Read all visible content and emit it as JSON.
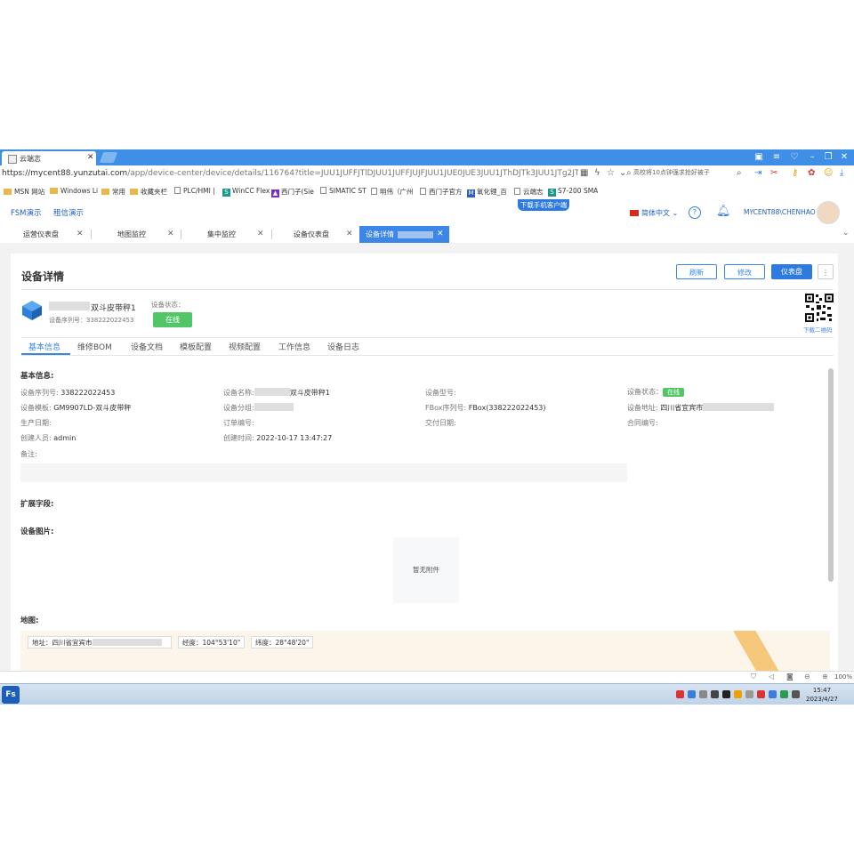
{
  "browser": {
    "tab_title": "云端志",
    "url_host": "https://mycent88.yunzutai.com",
    "url_path": "/app/device-center/device/details/116764?title=JUU1JUFFJTlDJUU1JUFFJUJFJUU1JUE0JUE3JUU1JThDJTk3JUU1JTg2JTlDJUU1JThGJThDJUUl",
    "search_placeholder": "高校将10点钟强求抢好被子"
  },
  "bookmarks": [
    {
      "label": "MSN 网站",
      "icon": "folder-icon"
    },
    {
      "label": "Windows Li",
      "icon": "folder-icon"
    },
    {
      "label": "常用",
      "icon": "folder-icon"
    },
    {
      "label": "收藏夹栏",
      "icon": "folder-icon"
    },
    {
      "label": "PLC/HMI |",
      "icon": "page-icon"
    },
    {
      "label": "WinCC Flex",
      "icon": "s-icon"
    },
    {
      "label": "西门子(Sie",
      "icon": "triangle-icon"
    },
    {
      "label": "SIMATIC ST",
      "icon": "page-icon"
    },
    {
      "label": "明伟（广州",
      "icon": "page-icon"
    },
    {
      "label": "西门子官方",
      "icon": "page-icon"
    },
    {
      "label": "氧化锂_百",
      "icon": "m-icon"
    },
    {
      "label": "云端志",
      "icon": "page-icon"
    },
    {
      "label": "S7-200 SMA",
      "icon": "s-icon"
    }
  ],
  "header": {
    "nav": [
      "FSM演示",
      "租信演示"
    ],
    "download_label": "下载手机客户端",
    "language": "简体中文",
    "user": "MYCENT88\\CHENHAO"
  },
  "page_tabs": [
    {
      "label": "运营仪表盘"
    },
    {
      "label": "地图监控"
    },
    {
      "label": "集中监控"
    },
    {
      "label": "设备仪表盘"
    },
    {
      "label": "设备详情"
    }
  ],
  "page": {
    "title": "设备详情",
    "buttons": {
      "refresh": "刷新",
      "edit": "修改",
      "dashboard": "仪表盘",
      "more": "⋮"
    },
    "device": {
      "name_suffix": "双斗皮带秤1",
      "serial_label": "设备序列号：338222022453",
      "status_label": "设备状态：",
      "status_value": "在线",
      "qr_label": "下载二维码"
    },
    "inner_tabs": [
      "基本信息",
      "维修BOM",
      "设备文档",
      "模板配置",
      "视频配置",
      "工作信息",
      "设备日志"
    ],
    "basic_title": "基本信息:",
    "fields": {
      "serial_k": "设备序列号:",
      "serial_v": "338222022453",
      "name_k": "设备名称:",
      "name_v": "双斗皮带秤1",
      "model_k": "设备型号:",
      "state_k": "设备状态：",
      "state_v": "在线",
      "template_k": "设备模板:",
      "template_v": "GM9907LD-双斗皮带秤",
      "group_k": "设备分组:",
      "fbox_k": "FBox序列号:",
      "fbox_v": "FBox(338222022453)",
      "addr_k": "设备地址:",
      "addr_v": "四川省宜宾市",
      "prod_k": "生产日期:",
      "order_k": "订单编号:",
      "deliver_k": "交付日期:",
      "contract_k": "合同编号:",
      "creator_k": "创建人员:",
      "creator_v": "admin",
      "ctime_k": "创建时间:",
      "ctime_v": "2022-10-17 13:47:27",
      "remark_k": "备注:"
    },
    "ext_title": "扩展字段:",
    "img_title": "设备图片:",
    "no_attach": "暂无附件",
    "map_title": "地图:",
    "map_address": "地址：四川省宜宾市",
    "map_lng": "经度：104°53'10\"",
    "map_lat": "纬度：28°48'20\""
  },
  "statusbar": {
    "zoom": "100%"
  },
  "taskbar": {
    "time": "15:47",
    "date": "2023/4/27",
    "start": "Fs"
  }
}
